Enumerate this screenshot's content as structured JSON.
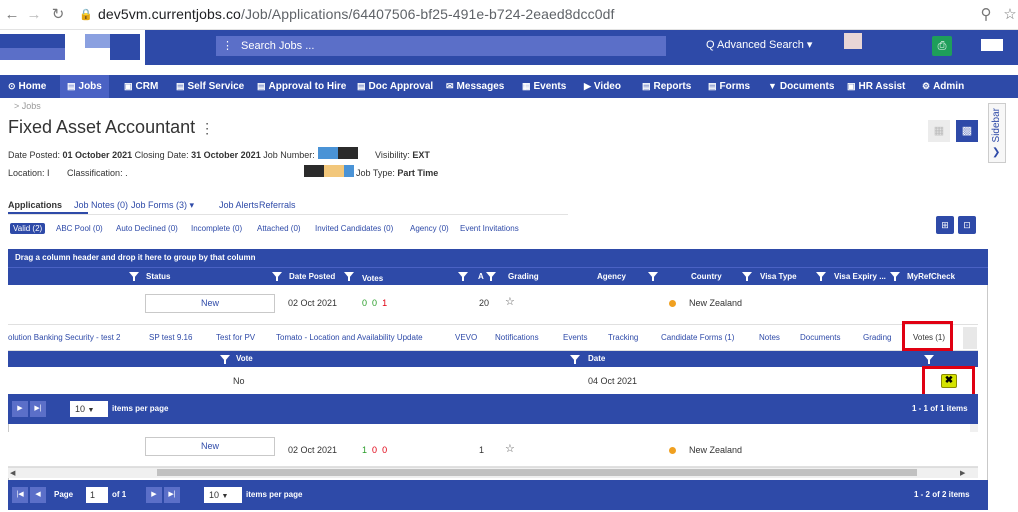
{
  "browser": {
    "url_domain": "dev5vm.currentjobs.co",
    "url_path": "/Job/Applications/64407506-bf25-491e-b724-2eaed8dcc0df"
  },
  "header": {
    "search_placeholder": "Search Jobs ...",
    "advanced_search": "Q Advanced Search ▾"
  },
  "menu": [
    {
      "label": "Home",
      "icon": "home-icon"
    },
    {
      "label": "Jobs",
      "icon": "folder-icon",
      "active": true
    },
    {
      "label": "CRM",
      "icon": "bank-icon"
    },
    {
      "label": "Self Service",
      "icon": "list-icon"
    },
    {
      "label": "Approval to Hire",
      "icon": "list-icon"
    },
    {
      "label": "Doc Approval",
      "icon": "list-icon"
    },
    {
      "label": "Messages",
      "icon": "envelope-icon"
    },
    {
      "label": "Events",
      "icon": "calendar-icon"
    },
    {
      "label": "Video",
      "icon": "video-icon"
    },
    {
      "label": "Reports",
      "icon": "file-icon"
    },
    {
      "label": "Forms",
      "icon": "forms-icon"
    },
    {
      "label": "Documents",
      "icon": "filter-icon"
    },
    {
      "label": "HR Assist",
      "icon": "bank-icon"
    },
    {
      "label": "Admin",
      "icon": "gear-icon"
    }
  ],
  "page": {
    "breadcrumb": "> Jobs",
    "title": "Fixed Asset Accountant",
    "date_posted_label": "Date Posted:",
    "date_posted": "01 October 2021",
    "closing_date_label": "Closing Date:",
    "closing_date": "31 October 2021",
    "job_number_label": "Job Number:",
    "visibility_label": "Visibility:",
    "visibility": "EXT",
    "location_label": "Location: I",
    "classification_label": "Classification: .",
    "job_type_label": "Job Type:",
    "job_type": "Part Time",
    "sidebar_label": "Sidebar"
  },
  "tabs": [
    "Applications",
    "Job Notes (0)",
    "Job Forms (3) ▾",
    "Job Alerts",
    "Referrals"
  ],
  "subtabs": [
    "Valid (2)",
    "ABC Pool (0)",
    "Auto Declined (0)",
    "Incomplete (0)",
    "Attached (0)",
    "Invited Candidates (0)",
    "Agency (0)",
    "Event Invitations"
  ],
  "grid": {
    "group_hint": "Drag a column header and drop it here to group by that column",
    "columns": [
      "Status",
      "Date Posted",
      "Votes",
      "A",
      "Grading",
      "Agency",
      "Country",
      "Visa Type",
      "Visa Expiry ...",
      "MyRefCheck"
    ],
    "rows": [
      {
        "status": "New",
        "date": "02 Oct 2021",
        "votes": [
          "0",
          "0",
          "1"
        ],
        "a": "20",
        "country": "New Zealand"
      },
      {
        "status": "New",
        "date": "02 Oct 2021",
        "votes": [
          "1",
          "0",
          "0"
        ],
        "a": "1",
        "country": "New Zealand"
      }
    ],
    "detail_tabs": [
      "olution Banking Security - test 2",
      "SP test 9.16",
      "Test for PV",
      "Tomato - Location and Availability Update",
      "VEVO",
      "Notifications",
      "Events",
      "Tracking",
      "Candidate Forms (1)",
      "Notes",
      "Documents",
      "Grading",
      "Votes (1)"
    ],
    "detail_columns": [
      "Vote",
      "Date"
    ],
    "detail_row": {
      "vote": "No",
      "date": "04 Oct 2021"
    },
    "inner_pager": {
      "page_size": "10",
      "items_per_page": "items per page",
      "summary": "1 - 1 of 1 items"
    },
    "outer_pager": {
      "page_label": "Page",
      "page": "1",
      "of_label": "of 1",
      "page_size": "10",
      "items_per_page": "items per page",
      "summary": "1 - 2 of 2 items"
    }
  },
  "colors": {
    "primary": "#2e4aa8",
    "highlight": "#e00012",
    "votes_green": "#2a9d2a",
    "votes_red": "#e00012"
  }
}
